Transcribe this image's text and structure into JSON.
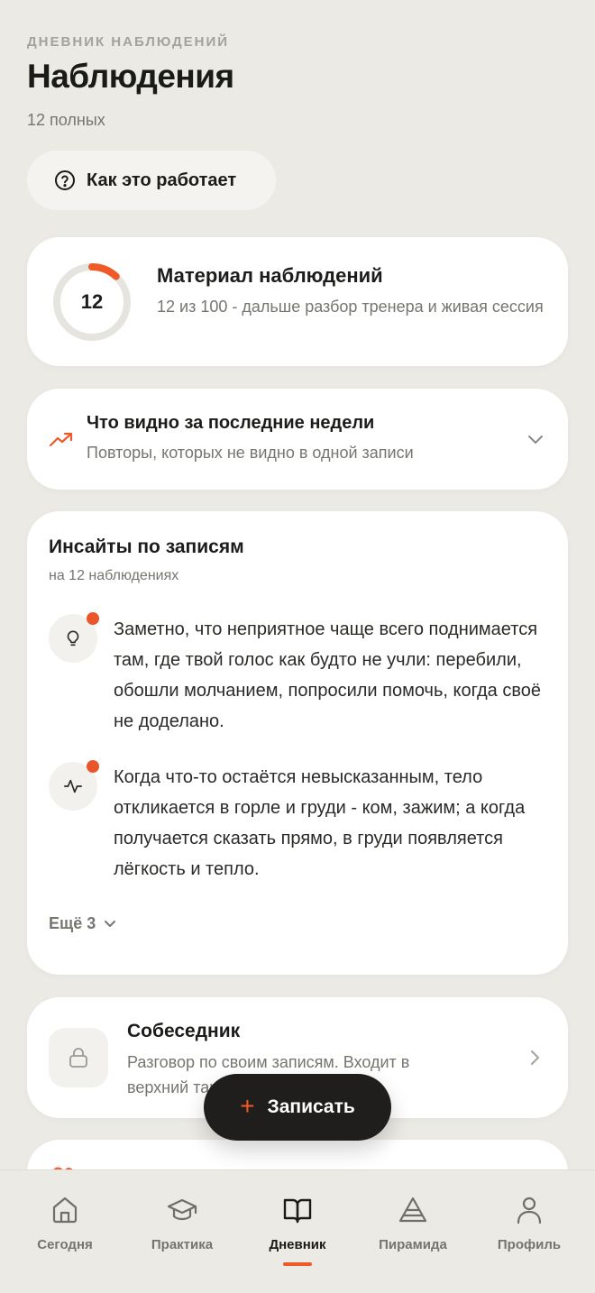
{
  "header": {
    "eyebrow": "ДНЕВНИК НАБЛЮДЕНИЙ",
    "title": "Наблюдения",
    "subtitle": "12 полных"
  },
  "how_button": {
    "label": "Как это работает",
    "icon": "question-circle-icon"
  },
  "material_card": {
    "count": "12",
    "progress": 12,
    "progress_max": 100,
    "title": "Материал наблюдений",
    "description": "12 из 100 - дальше разбор тренера и живая сессия"
  },
  "weeks_card": {
    "icon": "trend-up-icon",
    "title": "Что видно за последние недели",
    "description": "Повторы, которых не видно в одной записи"
  },
  "insights": {
    "title": "Инсайты по записям",
    "subtitle": "на 12 наблюдениях",
    "items": [
      {
        "icon": "lightbulb-icon",
        "text": "Заметно, что неприятное чаще всего поднимается там, где твой голос как будто не учли: перебили, обошли молчанием, попросили помочь, когда своё не доделано."
      },
      {
        "icon": "pulse-icon",
        "text": "Когда что-то остаётся невысказанным, тело откликается в горле и груди - ком, зажим; а когда получается сказать прямо, в груди появляется лёгкость и тепло."
      }
    ],
    "more_label": "Ещё 3"
  },
  "partner_card": {
    "icon": "lock-icon",
    "title": "Собеседник",
    "description": "Разговор по своим записям. Входит в верхний тариф"
  },
  "record_button": {
    "label": "Записать"
  },
  "tabbar": {
    "items": [
      {
        "label": "Сегодня",
        "icon": "home-icon"
      },
      {
        "label": "Практика",
        "icon": "graduation-cap-icon"
      },
      {
        "label": "Дневник",
        "icon": "book-icon"
      },
      {
        "label": "Пирамида",
        "icon": "pyramid-icon"
      },
      {
        "label": "Профиль",
        "icon": "user-icon"
      }
    ],
    "active": "Дневник"
  },
  "colors": {
    "accent": "#ef5a28",
    "background": "#ebeae5",
    "card": "#ffffff",
    "dark_button": "#1f1e1c"
  }
}
